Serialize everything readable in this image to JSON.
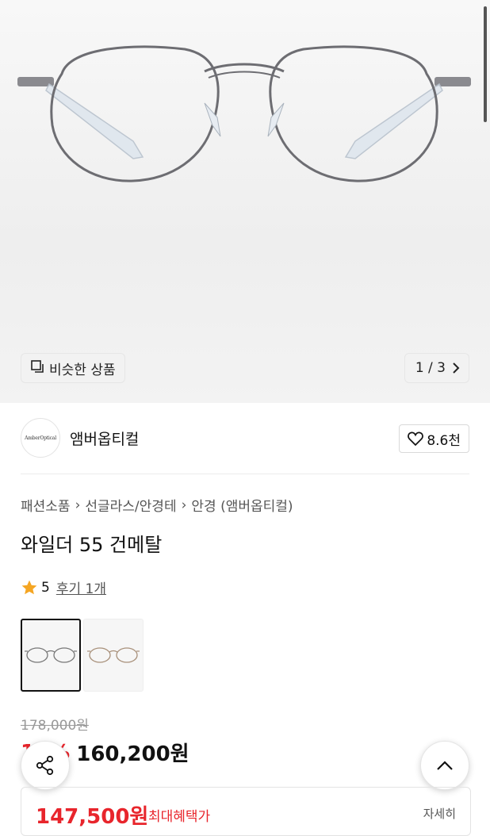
{
  "gallery": {
    "similar_label": "비슷한 상품",
    "counter": "1 / 3"
  },
  "brand": {
    "logo_text": "AmberOptical",
    "name": "앰버옵티컬",
    "likes": "8.6천"
  },
  "breadcrumb": [
    "패션소품",
    "선글라스/안경테",
    "안경 (앰버옵티컬)"
  ],
  "product": {
    "title": "와일더 55 건메탈",
    "rating": "5",
    "review_link": "후기 1개"
  },
  "pricing": {
    "original": "178,000원",
    "discount_rate": "10%",
    "sale": "160,200원",
    "benefit_price": "147,500원",
    "benefit_label": "최대혜택가",
    "benefit_detail": "자세히"
  },
  "colors": {
    "accent": "#e8252c",
    "star": "#f5a623"
  }
}
